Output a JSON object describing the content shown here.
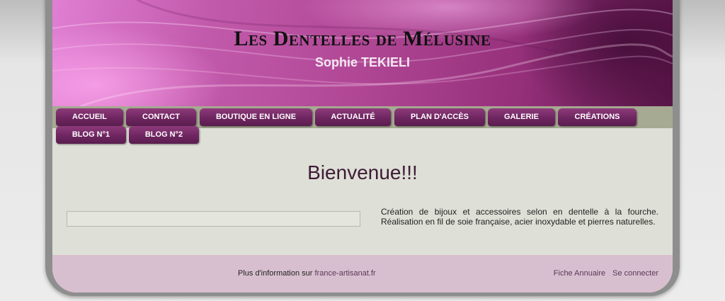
{
  "header": {
    "title": "Les Dentelles de Mélusine",
    "subtitle": "Sophie TEKIELI"
  },
  "nav": {
    "items": [
      {
        "label": "ACCUEIL"
      },
      {
        "label": "CONTACT"
      },
      {
        "label": "BOUTIQUE EN LIGNE"
      },
      {
        "label": "ACTUALITÉ"
      },
      {
        "label": "PLAN D'ACCÈS"
      },
      {
        "label": "GALERIE"
      },
      {
        "label": "CRÉATIONS"
      },
      {
        "label": "BLOG N°1"
      },
      {
        "label": "BLOG N°2"
      }
    ]
  },
  "content": {
    "title": "Bienvenue!!!",
    "description": "Création de bijoux et accessoires selon en dentelle à la fourche. Réalisation en fil de soie française, acier inoxydable et pierres naturelles."
  },
  "footer": {
    "info_prefix": "Plus d'information sur ",
    "info_link": "france-artisanat.fr",
    "links": {
      "annuaire": "Fiche Annuaire",
      "login": "Se connecter"
    }
  },
  "colors": {
    "accent": "#b04795",
    "tab": "#6e2660",
    "navbar": "#a7aa92",
    "footer": "#d8bfcf"
  }
}
